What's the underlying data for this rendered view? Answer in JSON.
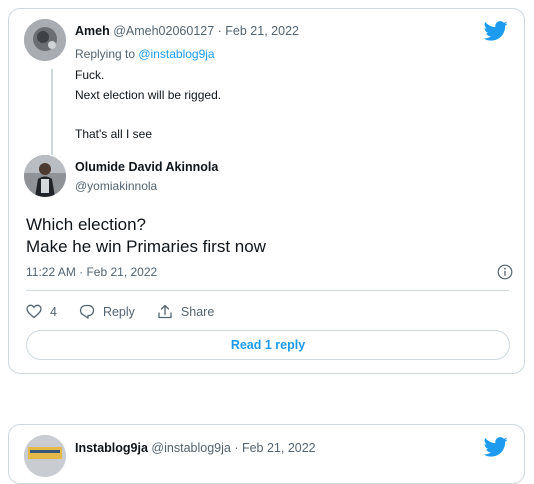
{
  "reply_tweet": {
    "author_name": "Ameh",
    "handle": "@Ameh02060127",
    "date_sep": " · ",
    "date": "Feb 21, 2022",
    "replying_prefix": "Replying to ",
    "replying_to": "@instablog9ja",
    "lines": [
      "Fuck.",
      "Next election will be rigged.",
      "",
      "That's all I see"
    ]
  },
  "main_tweet": {
    "author_name": "Olumide David Akinnola",
    "handle": "@yomiakinnola",
    "text_lines": [
      "Which election?",
      "Make he win Primaries first now"
    ],
    "timestamp": "11:22 AM · Feb 21, 2022",
    "likes": "4",
    "reply_label": "Reply",
    "share_label": "Share",
    "read_replies_label": "Read 1 reply"
  },
  "next_tweet": {
    "author_name": "Instablog9ja",
    "handle": "@instablog9ja",
    "date_sep": " · ",
    "date": "Feb 21, 2022"
  },
  "colors": {
    "twitter_blue": "#1d9bf0",
    "muted": "#536471",
    "border": "#cfd9de"
  },
  "icons": [
    "twitter-bird-icon",
    "info-icon",
    "heart-icon",
    "reply-icon",
    "share-icon"
  ]
}
